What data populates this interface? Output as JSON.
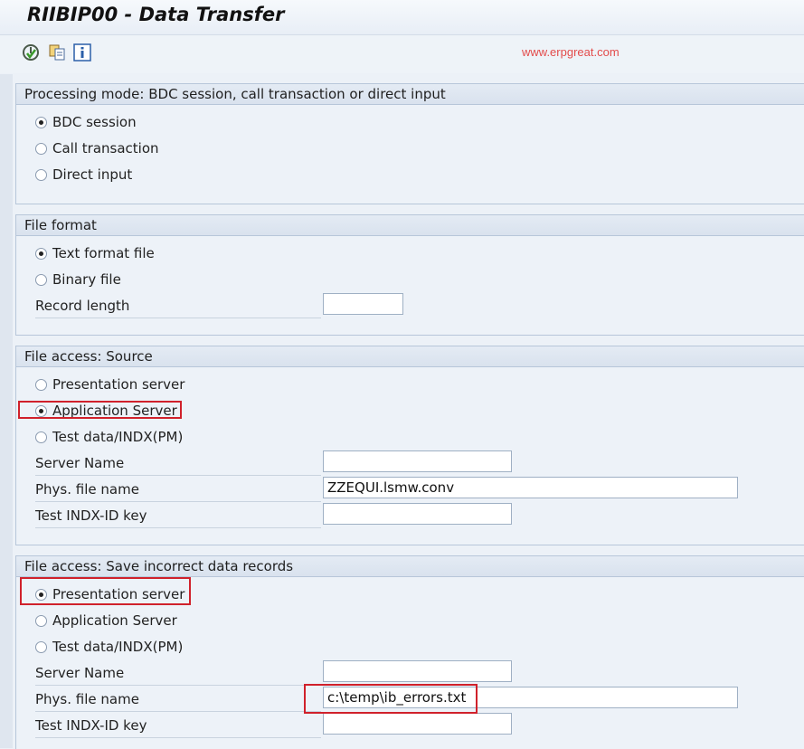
{
  "window": {
    "title": "RIIBIP00 - Data Transfer"
  },
  "toolbar": {
    "buttons": [
      {
        "icon": "execute-icon"
      },
      {
        "icon": "copy-variant-icon"
      },
      {
        "icon": "info-icon"
      }
    ],
    "watermark": "www.erpgreat.com"
  },
  "processing_mode": {
    "header": "Processing mode: BDC session, call transaction or direct input",
    "options": [
      {
        "label": "BDC session",
        "selected": true
      },
      {
        "label": "Call transaction",
        "selected": false
      },
      {
        "label": "Direct input",
        "selected": false
      }
    ]
  },
  "file_format": {
    "header": "File format",
    "options": [
      {
        "label": "Text format file",
        "selected": true
      },
      {
        "label": "Binary file",
        "selected": false
      }
    ],
    "record_length_label": "Record length",
    "record_length_value": ""
  },
  "source": {
    "header": "File access: Source",
    "options": [
      {
        "label": "Presentation server",
        "selected": false
      },
      {
        "label": "Application Server",
        "selected": true
      },
      {
        "label": "Test data/INDX(PM)",
        "selected": false
      }
    ],
    "server_name_label": "Server Name",
    "server_name_value": "",
    "phys_file_label": "Phys. file name",
    "phys_file_value": "ZZEQUI.lsmw.conv",
    "indx_label": "Test INDX-ID key",
    "indx_value": ""
  },
  "errors": {
    "header": "File access: Save incorrect data records",
    "options": [
      {
        "label": "Presentation server",
        "selected": true
      },
      {
        "label": "Application Server",
        "selected": false
      },
      {
        "label": "Test data/INDX(PM)",
        "selected": false
      }
    ],
    "server_name_label": "Server Name",
    "server_name_value": "",
    "phys_file_label": "Phys. file name",
    "phys_file_value": "c:\\temp\\ib_errors.txt",
    "indx_label": "Test INDX-ID key",
    "indx_value": ""
  },
  "colors": {
    "highlight": "#d0212b",
    "watermark": "#e34b4b"
  }
}
